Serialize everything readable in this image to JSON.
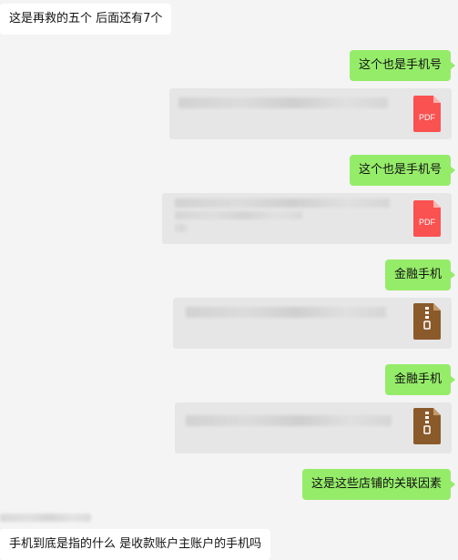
{
  "messages": [
    {
      "side": "in",
      "text": "这是再救的五个   后面还有7个"
    },
    {
      "side": "out",
      "text": "这个也是手机号"
    },
    {
      "side": "out",
      "type": "file",
      "file_type": "pdf",
      "icon_label": "PDF"
    },
    {
      "side": "out",
      "text": "这个也是手机号"
    },
    {
      "side": "out",
      "type": "file",
      "file_type": "pdf",
      "icon_label": "PDF"
    },
    {
      "side": "out",
      "text": "金融手机"
    },
    {
      "side": "out",
      "type": "file",
      "file_type": "zip"
    },
    {
      "side": "out",
      "text": "金融手机"
    },
    {
      "side": "out",
      "type": "file",
      "file_type": "zip"
    },
    {
      "side": "out",
      "text": "这是这些店铺的关联因素"
    },
    {
      "side": "in",
      "text": "手机到底是指的什么   是收款账户主账户的手机吗"
    }
  ],
  "colors": {
    "background": "#f4f4f4",
    "incoming_bubble": "#ffffff",
    "outgoing_bubble": "#95ec69",
    "file_card": "#e6e6e6",
    "pdf_icon": "#fa5151",
    "zip_icon": "#8a5a2b"
  }
}
